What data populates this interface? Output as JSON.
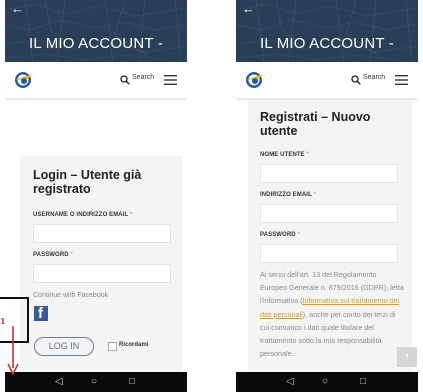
{
  "header": {
    "back_glyph": "←",
    "title": "IL MIO ACCOUNT -",
    "search_label": "Search"
  },
  "login_screen": {
    "card_title": "Login – Utente già registrato",
    "username_label": "USERNAME O INDIRIZZO EMAIL",
    "password_label": "PASSWORD",
    "required_mark": "*",
    "facebook_text": "Continue with Facebook",
    "facebook_glyph": "f",
    "login_button": "LOG IN",
    "remember_label": "Ricordami"
  },
  "register_screen": {
    "card_title": "Registrati – Nuovo utente",
    "username_label": "NOME UTENTE",
    "email_label": "INDIRIZZO EMAIL",
    "password_label": "PASSWORD",
    "required_mark": "*",
    "consent_text_1": "Ai sensi dell'art. 13 del Regolamento Europeo Generale n. 679/2016 (GDPR), letta l'informativa (",
    "consent_link": "Informativa sul trattamento dei dati personali",
    "consent_text_2": "), anche per conto dei terzi di cui comunico i dati quale titolare del trattamento sotto la mia responsabilità personale.",
    "scroll_top_glyph": "↑"
  },
  "nav_bar": {
    "back": "◁",
    "home": "○",
    "recents": "□"
  },
  "annotation": {
    "number": "1"
  },
  "colors": {
    "hero": "#2a3f57",
    "accent_link": "#d4a017",
    "button_border": "#6a7fa8",
    "facebook": "#3b5998"
  }
}
